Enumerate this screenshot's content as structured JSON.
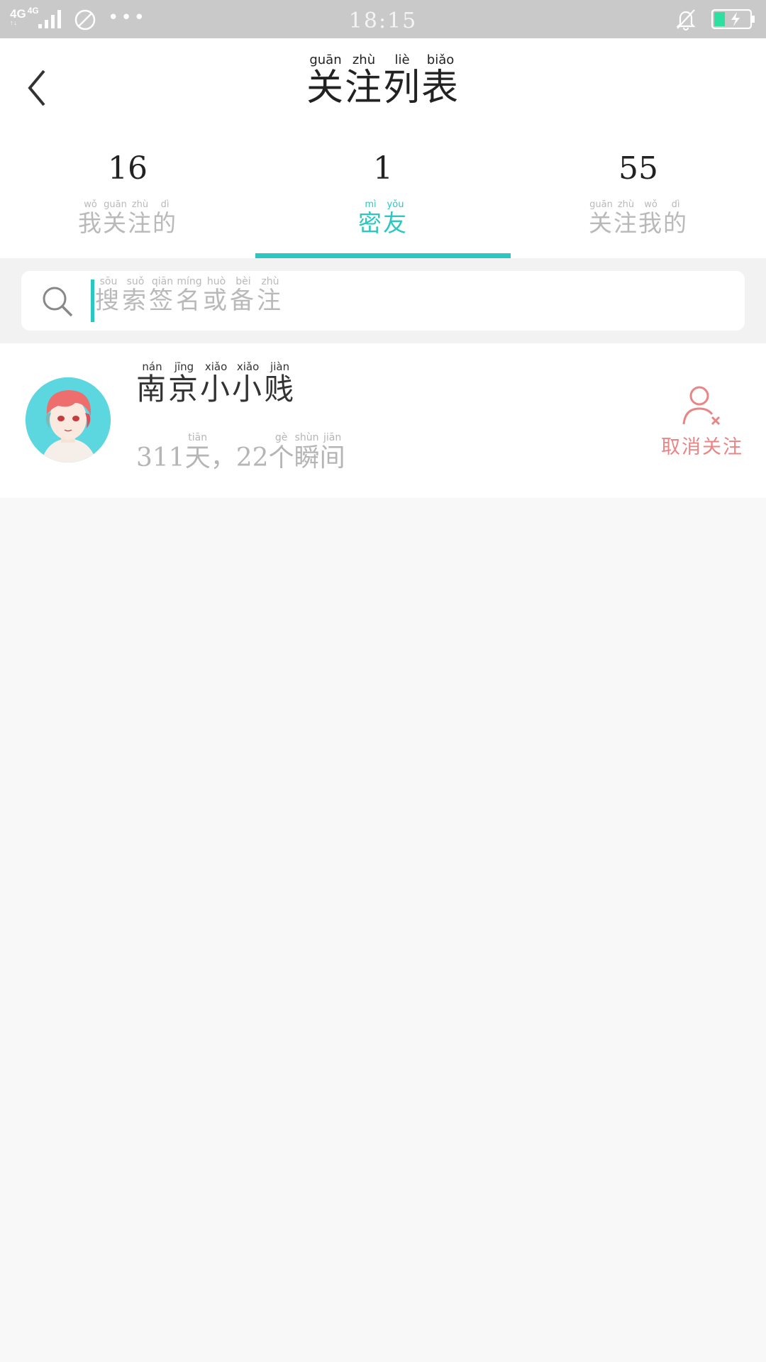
{
  "status_bar": {
    "network": "4G",
    "network2": "4G",
    "time": "18:15"
  },
  "header": {
    "title": [
      {
        "char": "关",
        "pinyin": "guān"
      },
      {
        "char": "注",
        "pinyin": "zhù"
      },
      {
        "char": "列",
        "pinyin": "liè"
      },
      {
        "char": "表",
        "pinyin": "biǎo"
      }
    ]
  },
  "tabs": [
    {
      "count": "16",
      "active": false,
      "label": [
        {
          "char": "我",
          "pinyin": "wǒ"
        },
        {
          "char": "关",
          "pinyin": "guān"
        },
        {
          "char": "注",
          "pinyin": "zhù"
        },
        {
          "char": "的",
          "pinyin": "dì"
        }
      ]
    },
    {
      "count": "1",
      "active": true,
      "label": [
        {
          "char": "密",
          "pinyin": "mì"
        },
        {
          "char": "友",
          "pinyin": "yǒu"
        }
      ]
    },
    {
      "count": "55",
      "active": false,
      "label": [
        {
          "char": "关",
          "pinyin": "guān"
        },
        {
          "char": "注",
          "pinyin": "zhù"
        },
        {
          "char": "我",
          "pinyin": "wǒ"
        },
        {
          "char": "的",
          "pinyin": "dì"
        }
      ]
    }
  ],
  "search": {
    "placeholder": [
      {
        "char": "搜",
        "pinyin": "sōu"
      },
      {
        "char": "索",
        "pinyin": "suǒ"
      },
      {
        "char": "签",
        "pinyin": "qiān"
      },
      {
        "char": "名",
        "pinyin": "míng"
      },
      {
        "char": "或",
        "pinyin": "huò"
      },
      {
        "char": "备",
        "pinyin": "bèi"
      },
      {
        "char": "注",
        "pinyin": "zhù"
      }
    ]
  },
  "friends": [
    {
      "name": [
        {
          "char": "南",
          "pinyin": "nán"
        },
        {
          "char": "京",
          "pinyin": "jīng"
        },
        {
          "char": "小",
          "pinyin": "xiǎo"
        },
        {
          "char": "小",
          "pinyin": "xiǎo"
        },
        {
          "char": "贱",
          "pinyin": "jiàn"
        }
      ],
      "meta": [
        {
          "char": "311",
          "pinyin": ""
        },
        {
          "char": "天",
          "pinyin": "tiān"
        },
        {
          "char": "，",
          "pinyin": ""
        },
        {
          "char": "22",
          "pinyin": ""
        },
        {
          "char": "个",
          "pinyin": "gè"
        },
        {
          "char": "瞬",
          "pinyin": "shùn"
        },
        {
          "char": "间",
          "pinyin": "jiān"
        }
      ],
      "action_label": "取消关注"
    }
  ],
  "colors": {
    "accent": "#2ac8c0",
    "unfollow": "#e98585",
    "status_bar": "#c9c9c9"
  },
  "icons": [
    "back-arrow-icon",
    "search-icon",
    "unfollow-user-icon",
    "bell-off-icon",
    "battery-charging-icon",
    "do-not-disturb-icon",
    "signal-icon"
  ]
}
